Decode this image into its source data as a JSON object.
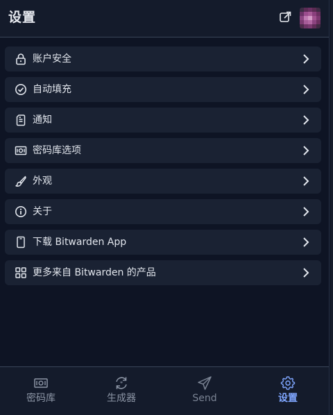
{
  "header": {
    "title": "设置",
    "popout_icon": "popout-icon",
    "avatar": "user-avatar"
  },
  "settings": {
    "items": [
      {
        "label": "账户安全",
        "icon": "lock-icon"
      },
      {
        "label": "自动填充",
        "icon": "check-circle-icon"
      },
      {
        "label": "通知",
        "icon": "notification-icon"
      },
      {
        "label": "密码库选项",
        "icon": "vault-icon"
      },
      {
        "label": "外观",
        "icon": "brush-icon"
      },
      {
        "label": "关于",
        "icon": "info-icon"
      },
      {
        "label": "下载 Bitwarden App",
        "icon": "mobile-icon"
      },
      {
        "label": "更多来自 Bitwarden 的产品",
        "icon": "grid-icon"
      }
    ]
  },
  "nav": {
    "items": [
      {
        "label": "密码库",
        "icon": "vault-icon",
        "state": "default"
      },
      {
        "label": "生成器",
        "icon": "generator-icon",
        "state": "default"
      },
      {
        "label": "Send",
        "icon": "send-icon",
        "state": "disabled"
      },
      {
        "label": "设置",
        "icon": "gear-icon",
        "state": "active"
      }
    ]
  },
  "colors": {
    "background": "#0e1424",
    "row": "#1a2233",
    "accent": "#7fa6ff",
    "text": "#e3e7ee"
  }
}
